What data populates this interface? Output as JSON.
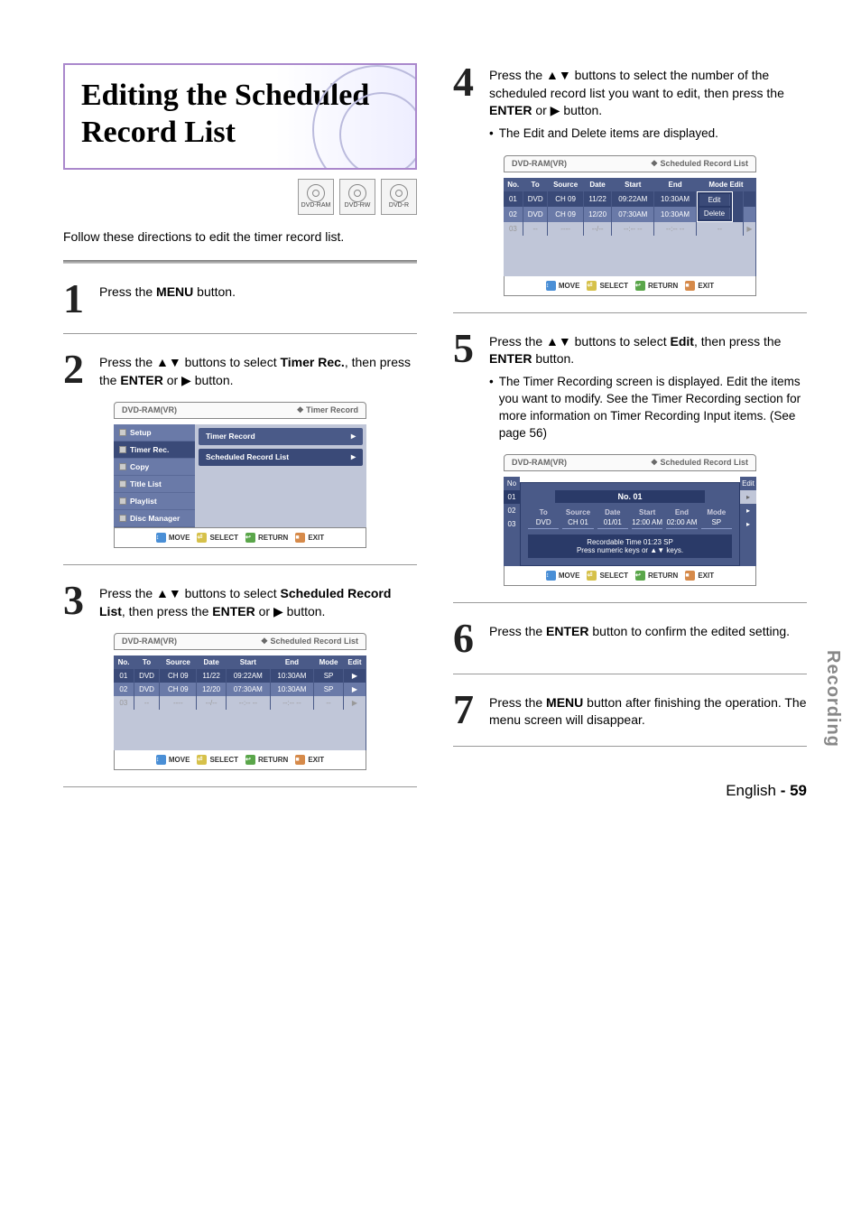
{
  "title": "Editing the Scheduled Record List",
  "discs": [
    "DVD-RAM",
    "DVD-RW",
    "DVD-R"
  ],
  "intro": "Follow these directions to edit the timer record list.",
  "steps": {
    "s1": {
      "num": "1",
      "body_a": "Press the ",
      "body_b": "MENU",
      "body_c": " button."
    },
    "s2": {
      "num": "2",
      "body_a": "Press the ▲▼ buttons to select ",
      "body_b": "Timer Rec.",
      "body_c": ", then press the ",
      "body_d": "ENTER",
      "body_e": " or ▶ button."
    },
    "s3": {
      "num": "3",
      "body_a": "Press the ▲▼ buttons to select ",
      "body_b": "Scheduled Record List",
      "body_c": ", then press the ",
      "body_d": "ENTER",
      "body_e": " or ▶ button."
    },
    "s4": {
      "num": "4",
      "body_a": "Press the ▲▼ buttons to select the number of the scheduled record list you want to edit, then press the ",
      "body_b": "ENTER",
      "body_c": " or ▶ button.",
      "bullet": "The Edit and Delete items are displayed."
    },
    "s5": {
      "num": "5",
      "body_a": "Press the ▲▼ buttons to select ",
      "body_b": "Edit",
      "body_c": ", then press the ",
      "body_d": "ENTER",
      "body_e": " button.",
      "bullet": "The Timer Recording screen is displayed. Edit the items you want to modify. See the Timer Recording section for more information on Timer Recording Input items. (See page 56)"
    },
    "s6": {
      "num": "6",
      "body_a": "Press the ",
      "body_b": "ENTER",
      "body_c": " button to confirm the edited setting."
    },
    "s7": {
      "num": "7",
      "body_a": "Press the ",
      "body_b": "MENU",
      "body_c": " button after finishing the operation. The menu screen will disappear."
    }
  },
  "osd": {
    "device": "DVD-RAM(VR)",
    "title_timer": "Timer Record",
    "title_list": "Scheduled Record List",
    "menu_items": [
      "Setup",
      "Timer Rec.",
      "Copy",
      "Title List",
      "Playlist",
      "Disc Manager"
    ],
    "submenu": [
      "Timer Record",
      "Scheduled Record List"
    ],
    "foot": {
      "move": "MOVE",
      "select": "SELECT",
      "return": "RETURN",
      "exit": "EXIT"
    },
    "cols": [
      "No.",
      "To",
      "Source",
      "Date",
      "Start",
      "End",
      "Mode",
      "Edit"
    ],
    "rows3": [
      {
        "no": "01",
        "to": "DVD",
        "src": "CH  09",
        "date": "11/22",
        "start": "09:22AM",
        "end": "10:30AM",
        "mode": "SP",
        "edit": "▶"
      },
      {
        "no": "02",
        "to": "DVD",
        "src": "CH  09",
        "date": "12/20",
        "start": "07:30AM",
        "end": "10:30AM",
        "mode": "SP",
        "edit": "▶"
      },
      {
        "no": "03",
        "to": "--",
        "src": "----",
        "date": "--/--",
        "start": "--:-- --",
        "end": "--:-- --",
        "mode": "--",
        "edit": "▶"
      }
    ],
    "rows4": [
      {
        "no": "01",
        "to": "DVD",
        "src": "CH  09",
        "date": "11/22",
        "start": "09:22AM",
        "end": "10:30AM",
        "edit_opts": [
          "Edit",
          "Delete"
        ]
      },
      {
        "no": "02",
        "to": "DVD",
        "src": "CH  09",
        "date": "12/20",
        "start": "07:30AM",
        "end": "10:30AM",
        "mode_edit": ""
      },
      {
        "no": "03",
        "to": "--",
        "src": "----",
        "date": "--/--",
        "start": "--:-- --",
        "end": "--:-- --",
        "mode_edit": "▶"
      }
    ],
    "inner": {
      "title": "No. 01",
      "side_no": [
        "No",
        "01",
        "02",
        "03"
      ],
      "side_edit": "Edit",
      "hdr": [
        "To",
        "Source",
        "Date",
        "Start",
        "End",
        "Mode"
      ],
      "val": [
        "DVD",
        "CH 01",
        "01/01",
        "12:00 AM",
        "02:00 AM",
        "SP"
      ],
      "msg1": "Recordable Time 01:23 SP",
      "msg2": "Press numeric keys or ▲▼ keys."
    }
  },
  "side_tab": "Recording",
  "footer": {
    "lang": "English",
    "dash": " - ",
    "page": "59"
  }
}
